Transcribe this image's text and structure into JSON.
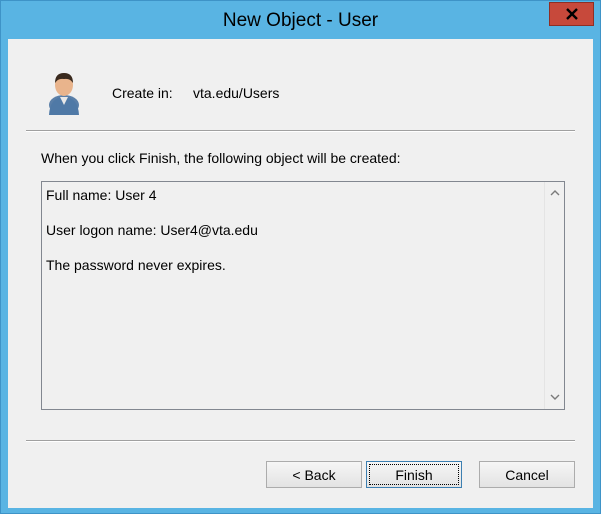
{
  "window": {
    "title": "New Object - User"
  },
  "header": {
    "icon": "user-icon",
    "create_in_label": "Create in:",
    "create_in_value": "vta.edu/Users"
  },
  "main": {
    "intro": "When you click Finish, the following object will be created:",
    "summary_lines": [
      "Full name: User 4",
      "User logon name: User4@vta.edu",
      "The password never expires."
    ]
  },
  "buttons": {
    "back": "< Back",
    "finish": "Finish",
    "cancel": "Cancel"
  },
  "colors": {
    "frame": "#59b4e3",
    "close": "#c7493b",
    "client": "#f0f0f0"
  }
}
